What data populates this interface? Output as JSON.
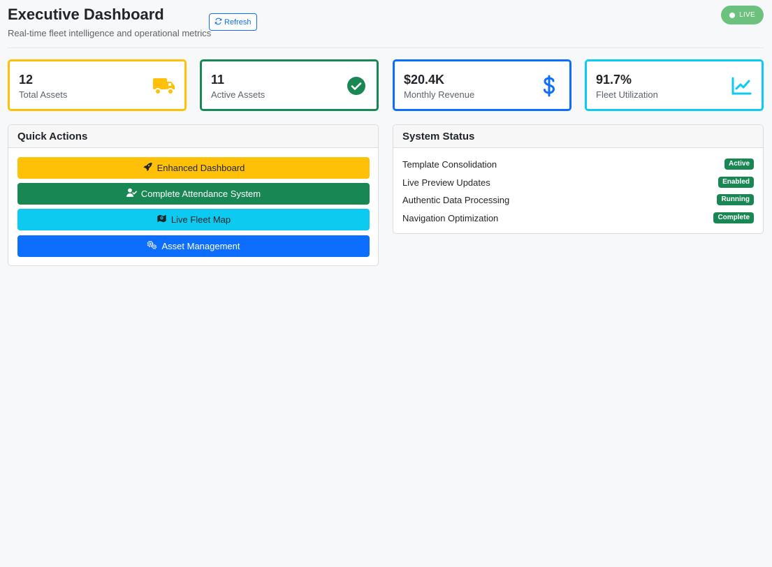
{
  "header": {
    "title": "Executive Dashboard",
    "subtitle": "Real-time fleet intelligence and operational metrics",
    "refresh_label": "Refresh",
    "live_label": "LIVE"
  },
  "stats": [
    {
      "value": "12",
      "label": "Total Assets",
      "icon": "truck-icon",
      "color": "#ffc107"
    },
    {
      "value": "11",
      "label": "Active Assets",
      "icon": "check-circle-icon",
      "color": "#198754"
    },
    {
      "value": "$20.4K",
      "label": "Monthly Revenue",
      "icon": "dollar-icon",
      "color": "#0d6efd"
    },
    {
      "value": "91.7%",
      "label": "Fleet Utilization",
      "icon": "line-chart-icon",
      "color": "#0dcaf0"
    }
  ],
  "quick_actions": {
    "title": "Quick Actions",
    "items": [
      {
        "label": "Enhanced Dashboard",
        "icon": "rocket-icon",
        "bg": "#ffc107",
        "fg": "#212529"
      },
      {
        "label": "Complete Attendance System",
        "icon": "user-check-icon",
        "bg": "#198754",
        "fg": "#ffffff"
      },
      {
        "label": "Live Fleet Map",
        "icon": "map-icon",
        "bg": "#0dcaf0",
        "fg": "#212529"
      },
      {
        "label": "Asset Management",
        "icon": "gears-icon",
        "bg": "#0d6efd",
        "fg": "#ffffff"
      }
    ]
  },
  "system_status": {
    "title": "System Status",
    "items": [
      {
        "label": "Template Consolidation",
        "status": "Active"
      },
      {
        "label": "Live Preview Updates",
        "status": "Enabled"
      },
      {
        "label": "Authentic Data Processing",
        "status": "Running"
      },
      {
        "label": "Navigation Optimization",
        "status": "Complete"
      }
    ]
  },
  "colors": {
    "background": "#f7f8fa",
    "live_badge": "#6cc17e",
    "status_badge": "#198754"
  }
}
